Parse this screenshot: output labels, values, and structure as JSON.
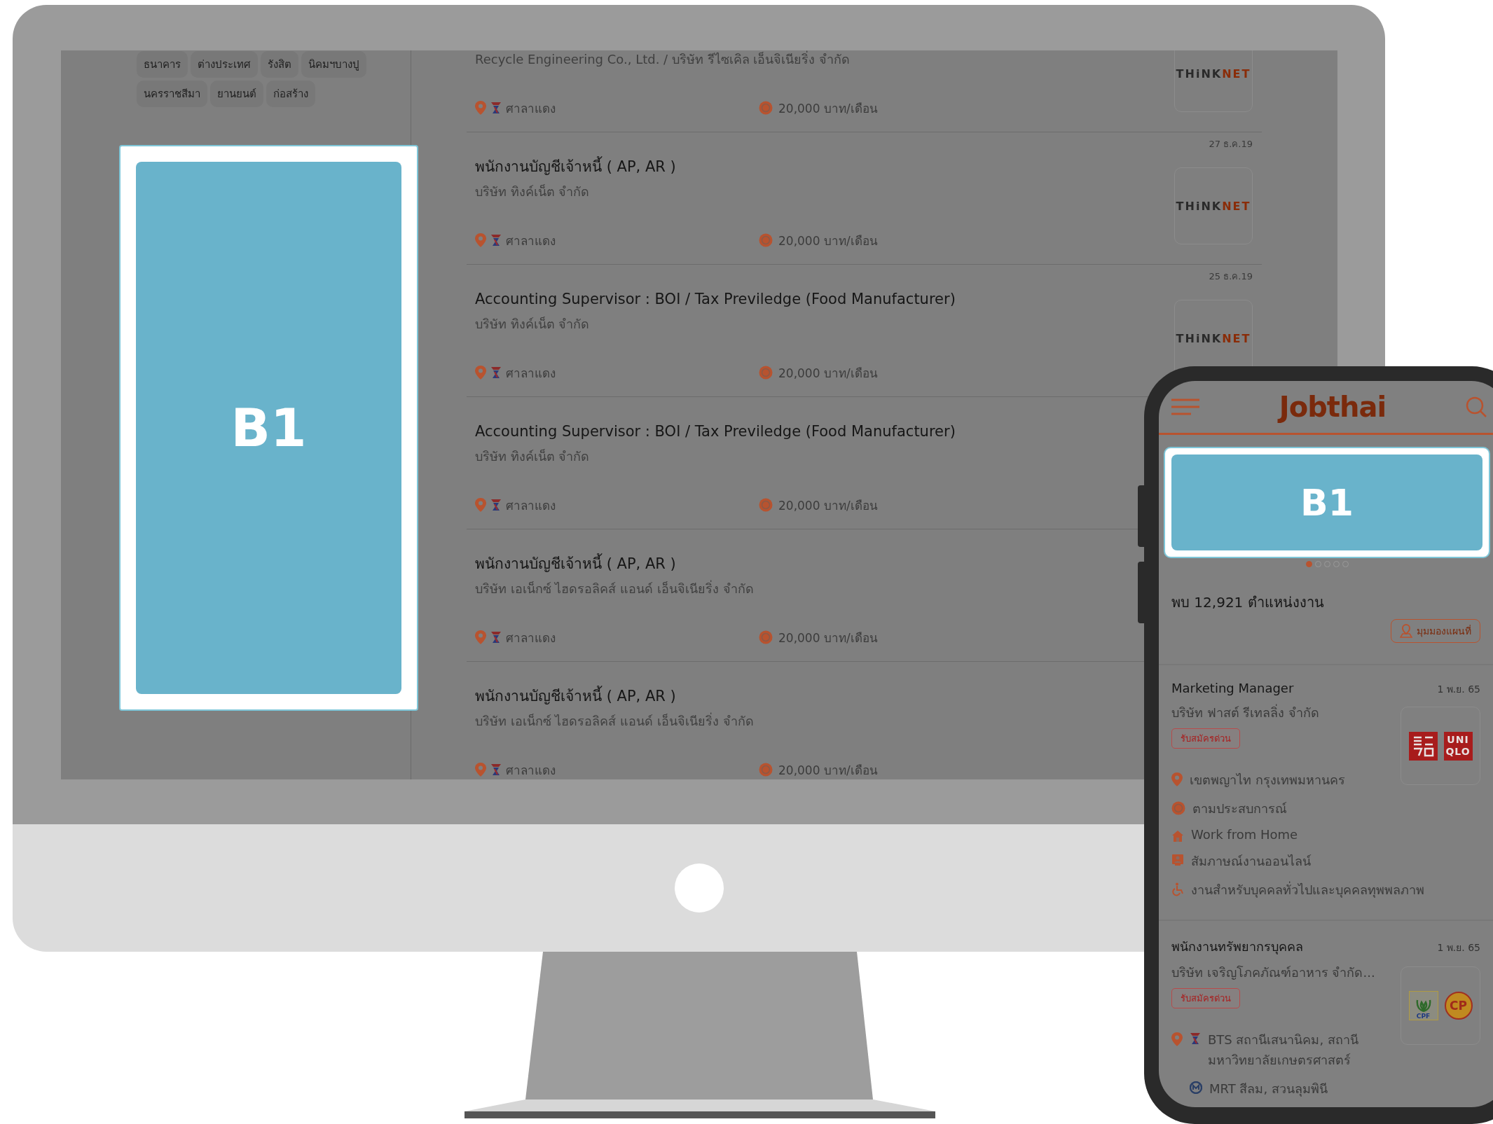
{
  "desktop": {
    "sidebar": {
      "tags": [
        {
          "label": "ธนาคาร"
        },
        {
          "label": "ต่างประเทศ"
        },
        {
          "label": "รังสิต"
        },
        {
          "label": "นิคมฯบางปู"
        },
        {
          "label": "นครราชสีมา"
        },
        {
          "label": "ยานยนต์"
        },
        {
          "label": "ก่อสร้าง"
        }
      ],
      "banner": {
        "label": "B1"
      }
    },
    "jobs": [
      {
        "company": "Recycle Engineering Co., Ltd. / บริษัท รีไซเคิล เอ็นจิเนียริ่ง จำกัด",
        "location": "ศาลาแดง",
        "salary": "20,000 บาท/เดือน",
        "logo": {
          "kind": "thinknet",
          "parts": [
            "THiNK",
            "NET"
          ]
        }
      },
      {
        "date": "27 ธ.ค.19",
        "title": "พนักงานบัญชีเจ้าหนี้ ( AP, AR )",
        "company": "บริษัท ทิงค์เน็ต จำกัด",
        "location": "ศาลาแดง",
        "salary": "20,000 บาท/เดือน",
        "logo": {
          "kind": "thinknet",
          "parts": [
            "THiNK",
            "NET"
          ]
        }
      },
      {
        "date": "25 ธ.ค.19",
        "title": "Accounting Supervisor : BOI / Tax Previledge (Food Manufacturer)",
        "company": "บริษัท ทิงค์เน็ต จำกัด",
        "location": "ศาลาแดง",
        "salary": "20,000 บาท/เดือน",
        "logo": {
          "kind": "thinknet",
          "parts": [
            "THiNK",
            "NET"
          ]
        }
      },
      {
        "title": "Accounting Supervisor : BOI / Tax Previledge (Food Manufacturer)",
        "company": "บริษัท ทิงค์เน็ต จำกัด",
        "location": "ศาลาแดง",
        "salary": "20,000 บาท/เดือน"
      },
      {
        "title": "พนักงานบัญชีเจ้าหนี้ ( AP, AR )",
        "company": "บริษัท เอเน็กซ์ ไฮดรอลิคส์ แอนด์ เอ็นจิเนียริ่ง จำกัด",
        "location": "ศาลาแดง",
        "salary": "20,000 บาท/เดือน"
      },
      {
        "title": "พนักงานบัญชีเจ้าหนี้ ( AP, AR )",
        "company": "บริษัท เอเน็กซ์ ไฮดรอลิคส์ แอนด์ เอ็นจิเนียริ่ง จำกัด",
        "location": "ศาลาแดง",
        "salary": "20,000 บาท/เดือน"
      }
    ]
  },
  "phone": {
    "brand": "Jobthai",
    "banner": {
      "label": "B1"
    },
    "carousel": [
      {
        "selected": true
      },
      {
        "selected": false
      },
      {
        "selected": false
      },
      {
        "selected": false
      },
      {
        "selected": false
      }
    ],
    "result_count": "พบ 12,921 ตำแหน่งงาน",
    "map_button": "มุมมองแผนที่",
    "jobs": [
      {
        "title": "Marketing Manager",
        "date": "1 พ.ย. 65",
        "company": "บริษัท ฟาสต์ รีเทลลิ่ง จำกัด",
        "badge": "รับสมัครด่วน",
        "logo": {
          "kind": "uniqlo",
          "parts": [
            "UNI",
            "QLO"
          ]
        },
        "details": [
          {
            "kind": "location",
            "text": "เขตพญาไท กรุงเทพมหานคร"
          },
          {
            "kind": "salary",
            "text": "ตามประสบการณ์"
          },
          {
            "kind": "home",
            "text": "Work from Home"
          },
          {
            "kind": "interview",
            "text": "สัมภาษณ์งานออนไลน์"
          },
          {
            "kind": "accessible",
            "text": "งานสำหรับบุคคลทั่วไปและบุคคลทุพพลภาพ"
          }
        ]
      },
      {
        "title": "พนักงานทรัพยากรบุคคล",
        "date": "1 พ.ย. 65",
        "company": "บริษัท เจริญโภคภัณฑ์อาหาร จำกัด...",
        "badge": "รับสมัครด่วน",
        "logo": {
          "kind": "cpf",
          "parts": [
            "CPF",
            "CP"
          ]
        },
        "details": [
          {
            "kind": "bts",
            "text": "BTS สถานีเสนานิคม, สถานี มหาวิทยาลัยเกษตรศาสตร์"
          },
          {
            "kind": "mrt",
            "text": "MRT สีลม, สวนลุมพินี"
          }
        ]
      }
    ]
  }
}
